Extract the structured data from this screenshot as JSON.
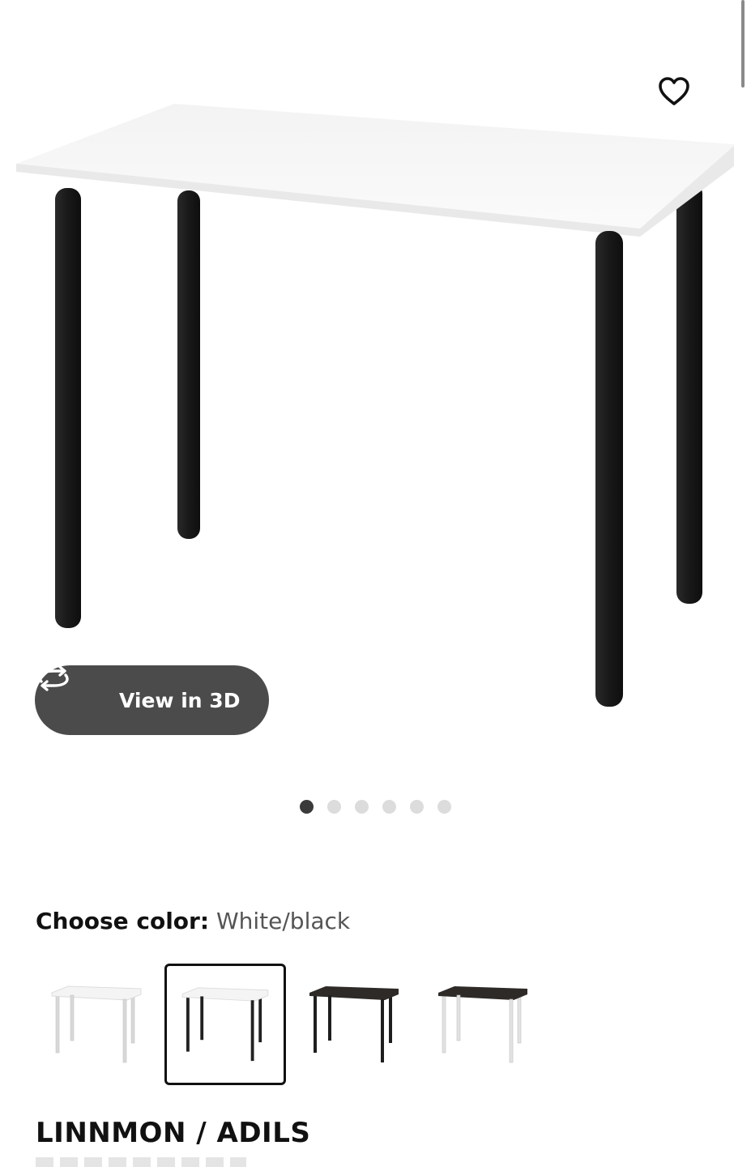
{
  "hero": {
    "image_icon": "table-product-image",
    "favorite_icon": "heart-outline-icon",
    "view_3d_label": "View in 3D",
    "view_3d_icon": "rotate-3d-icon",
    "carousel": {
      "count": 6,
      "active_index": 0
    }
  },
  "color_picker": {
    "label": "Choose color:",
    "selected_value": "White/black",
    "options": [
      {
        "name": "white-white",
        "top": "#f4f4f4",
        "legs": "#ffffff"
      },
      {
        "name": "white-black",
        "top": "#f4f4f4",
        "legs": "#222222"
      },
      {
        "name": "black-brown-black",
        "top": "#2e2a28",
        "legs": "#222222"
      },
      {
        "name": "black-brown-white",
        "top": "#2e2a28",
        "legs": "#ffffff"
      }
    ],
    "selected_index": 1
  },
  "product": {
    "title": "LINNMON / ADILS"
  },
  "colors": {
    "pill_bg": "#4b4b4b",
    "dot_active": "#3a3a3a",
    "dot_inactive": "#dcdcdc",
    "leg_black": "#1c1c1c",
    "table_top": "#f6f6f6"
  }
}
